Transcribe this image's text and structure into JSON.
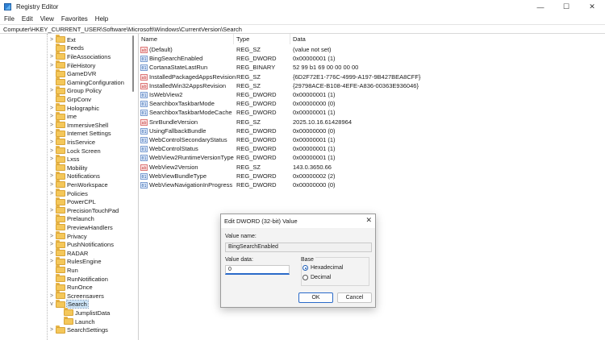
{
  "window": {
    "title": "Registry Editor",
    "minimize_glyph": "—",
    "maximize_glyph": "☐",
    "close_glyph": "✕"
  },
  "menu": [
    "File",
    "Edit",
    "View",
    "Favorites",
    "Help"
  ],
  "address": "Computer\\HKEY_CURRENT_USER\\Software\\Microsoft\\Windows\\CurrentVersion\\Search",
  "tree": [
    {
      "label": "Ext",
      "expander": ">",
      "level": 0
    },
    {
      "label": "Feeds",
      "expander": "",
      "level": 0
    },
    {
      "label": "FileAssociations",
      "expander": ">",
      "level": 0
    },
    {
      "label": "FileHistory",
      "expander": ">",
      "level": 0
    },
    {
      "label": "GameDVR",
      "expander": "",
      "level": 0
    },
    {
      "label": "GamingConfiguration",
      "expander": "",
      "level": 0
    },
    {
      "label": "Group Policy",
      "expander": ">",
      "level": 0
    },
    {
      "label": "GrpConv",
      "expander": "",
      "level": 0
    },
    {
      "label": "Holographic",
      "expander": ">",
      "level": 0
    },
    {
      "label": "ime",
      "expander": ">",
      "level": 0
    },
    {
      "label": "ImmersiveShell",
      "expander": ">",
      "level": 0
    },
    {
      "label": "Internet Settings",
      "expander": ">",
      "level": 0
    },
    {
      "label": "IrisService",
      "expander": ">",
      "level": 0
    },
    {
      "label": "Lock Screen",
      "expander": ">",
      "level": 0
    },
    {
      "label": "Lxss",
      "expander": ">",
      "level": 0
    },
    {
      "label": "Mobility",
      "expander": "",
      "level": 0
    },
    {
      "label": "Notifications",
      "expander": ">",
      "level": 0
    },
    {
      "label": "PenWorkspace",
      "expander": ">",
      "level": 0
    },
    {
      "label": "Policies",
      "expander": ">",
      "level": 0
    },
    {
      "label": "PowerCPL",
      "expander": "",
      "level": 0
    },
    {
      "label": "PrecisionTouchPad",
      "expander": ">",
      "level": 0
    },
    {
      "label": "Prelaunch",
      "expander": "",
      "level": 0
    },
    {
      "label": "PreviewHandlers",
      "expander": "",
      "level": 0
    },
    {
      "label": "Privacy",
      "expander": ">",
      "level": 0
    },
    {
      "label": "PushNotifications",
      "expander": ">",
      "level": 0
    },
    {
      "label": "RADAR",
      "expander": ">",
      "level": 0
    },
    {
      "label": "RulesEngine",
      "expander": ">",
      "level": 0
    },
    {
      "label": "Run",
      "expander": "",
      "level": 0
    },
    {
      "label": "RunNotification",
      "expander": "",
      "level": 0
    },
    {
      "label": "RunOnce",
      "expander": "",
      "level": 0
    },
    {
      "label": "Screensavers",
      "expander": ">",
      "level": 0
    },
    {
      "label": "Search",
      "expander": "v",
      "level": 0,
      "selected": true
    },
    {
      "label": "JumplistData",
      "expander": "",
      "level": 1
    },
    {
      "label": "Launch",
      "expander": "",
      "level": 1
    },
    {
      "label": "SearchSettings",
      "expander": ">",
      "level": 0
    }
  ],
  "columns": {
    "name": "Name",
    "type": "Type",
    "data": "Data"
  },
  "values": [
    {
      "icon": "ab",
      "name": "(Default)",
      "type": "REG_SZ",
      "data": "(value not set)"
    },
    {
      "icon": "01",
      "name": "BingSearchEnabled",
      "type": "REG_DWORD",
      "data": "0x00000001 (1)"
    },
    {
      "icon": "01",
      "name": "CortanaStateLastRun",
      "type": "REG_BINARY",
      "data": "52 99 b1 69 00 00 00 00"
    },
    {
      "icon": "ab",
      "name": "InstalledPackagedAppsRevision",
      "type": "REG_SZ",
      "data": "{6D2F72E1-776C-4999-A197-9B427BEA8CFF}"
    },
    {
      "icon": "ab",
      "name": "InstalledWin32AppsRevision",
      "type": "REG_SZ",
      "data": "{29798ACE-B108-4EFE-A836-00363E936046}"
    },
    {
      "icon": "01",
      "name": "IsWebView2",
      "type": "REG_DWORD",
      "data": "0x00000001 (1)"
    },
    {
      "icon": "01",
      "name": "SearchboxTaskbarMode",
      "type": "REG_DWORD",
      "data": "0x00000000 (0)"
    },
    {
      "icon": "01",
      "name": "SearchboxTaskbarModeCache",
      "type": "REG_DWORD",
      "data": "0x00000001 (1)"
    },
    {
      "icon": "ab",
      "name": "SnrBundleVersion",
      "type": "REG_SZ",
      "data": "2025.10.16.61428964"
    },
    {
      "icon": "01",
      "name": "UsingFallbackBundle",
      "type": "REG_DWORD",
      "data": "0x00000000 (0)"
    },
    {
      "icon": "01",
      "name": "WebControlSecondaryStatus",
      "type": "REG_DWORD",
      "data": "0x00000001 (1)"
    },
    {
      "icon": "01",
      "name": "WebControlStatus",
      "type": "REG_DWORD",
      "data": "0x00000001 (1)"
    },
    {
      "icon": "01",
      "name": "WebView2RuntimeVersionType",
      "type": "REG_DWORD",
      "data": "0x00000001 (1)"
    },
    {
      "icon": "ab",
      "name": "WebView2Version",
      "type": "REG_SZ",
      "data": "143.0.3650.66"
    },
    {
      "icon": "01",
      "name": "WebViewBundleType",
      "type": "REG_DWORD",
      "data": "0x00000002 (2)"
    },
    {
      "icon": "01",
      "name": "WebViewNavigationInProgress",
      "type": "REG_DWORD",
      "data": "0x00000000 (0)"
    }
  ],
  "dialog": {
    "title": "Edit DWORD (32-bit) Value",
    "close_glyph": "✕",
    "value_name_label": "Value name:",
    "value_name": "BingSearchEnabled",
    "value_data_label": "Value data:",
    "value_data": "0",
    "base_label": "Base",
    "hex_label": "Hexadecimal",
    "dec_label": "Decimal",
    "selected_base": "Hexadecimal",
    "ok_label": "OK",
    "cancel_label": "Cancel"
  }
}
